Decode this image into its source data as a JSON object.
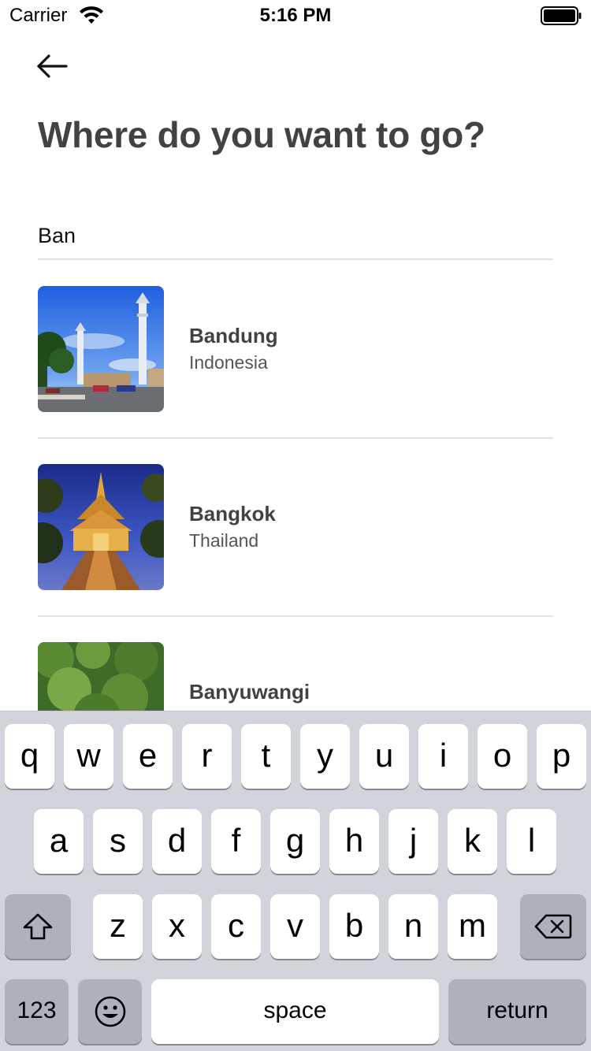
{
  "status_bar": {
    "carrier": "Carrier",
    "time": "5:16 PM"
  },
  "header": {
    "back_icon": "arrow-left-icon",
    "title": "Where do you want to go?"
  },
  "search": {
    "value": "Ban",
    "placeholder": ""
  },
  "results": [
    {
      "name": "Bandung",
      "country": "Indonesia"
    },
    {
      "name": "Bangkok",
      "country": "Thailand"
    },
    {
      "name": "Banyuwangi",
      "country": ""
    }
  ],
  "keyboard": {
    "row1": [
      "q",
      "w",
      "e",
      "r",
      "t",
      "y",
      "u",
      "i",
      "o",
      "p"
    ],
    "row2": [
      "a",
      "s",
      "d",
      "f",
      "g",
      "h",
      "j",
      "k",
      "l"
    ],
    "row3": [
      "z",
      "x",
      "c",
      "v",
      "b",
      "n",
      "m"
    ],
    "shift_icon": "shift-icon",
    "delete_icon": "delete-icon",
    "numbers_label": "123",
    "emoji_icon": "emoji-icon",
    "space_label": "space",
    "return_label": "return"
  },
  "colors": {
    "title": "#424242",
    "keyboard_bg": "#d1d4da",
    "divider": "#e4e4e4"
  }
}
